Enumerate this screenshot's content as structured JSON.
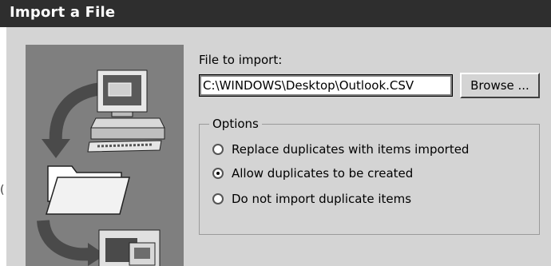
{
  "window": {
    "title": "Import a File"
  },
  "file_input": {
    "label": "File to import:",
    "value": "C:\\WINDOWS\\Desktop\\Outlook.CSV"
  },
  "browse_button": {
    "label": "Browse ..."
  },
  "options": {
    "legend": "Options",
    "items": [
      {
        "label": "Replace duplicates with items imported",
        "selected": false
      },
      {
        "label": "Allow duplicates to be created",
        "selected": true
      },
      {
        "label": "Do not import duplicate items",
        "selected": false
      }
    ]
  },
  "edge_mark": "("
}
